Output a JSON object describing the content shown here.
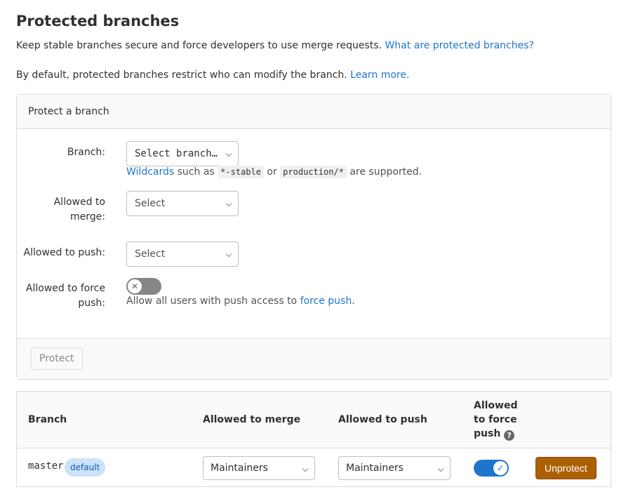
{
  "page": {
    "title": "Protected branches",
    "intro_text": "Keep stable branches secure and force developers to use merge requests.",
    "intro_link": "What are protected branches?",
    "default_text": "By default, protected branches restrict who can modify the branch.",
    "default_link": "Learn more."
  },
  "form": {
    "header": "Protect a branch",
    "branch_label": "Branch:",
    "branch_value": "Select branch…",
    "wildcards_link": "Wildcards",
    "wildcards_text1": "such as",
    "wildcards_code1": "*-stable",
    "wildcards_text2": "or",
    "wildcards_code2": "production/*",
    "wildcards_text3": "are supported.",
    "merge_label_1": "Allowed to",
    "merge_label_2": "merge:",
    "merge_value": "Select",
    "push_label": "Allowed to push:",
    "push_value": "Select",
    "force_label_1": "Allowed to force",
    "force_label_2": "push:",
    "force_help": "Allow all users with push access to",
    "force_link": "force push",
    "force_period": ".",
    "force_enabled": false,
    "protect_button": "Protect"
  },
  "table": {
    "headers": {
      "branch": "Branch",
      "merge": "Allowed to merge",
      "push": "Allowed to push",
      "force_1": "Allowed",
      "force_2": "to force",
      "force_3": "push"
    },
    "rows": [
      {
        "branch": "master",
        "badge": "default",
        "merge": "Maintainers",
        "push": "Maintainers",
        "force_push": true,
        "unprotect": "Unprotect"
      }
    ]
  },
  "colors": {
    "link": "#1f75cb",
    "toggle_on": "#1f75cb",
    "unprotect": "#ab6100",
    "badge_bg": "#cbe2f9"
  },
  "icons": {
    "toggle_off": "close-icon",
    "toggle_on": "check-icon",
    "help": "question-circle-icon"
  }
}
